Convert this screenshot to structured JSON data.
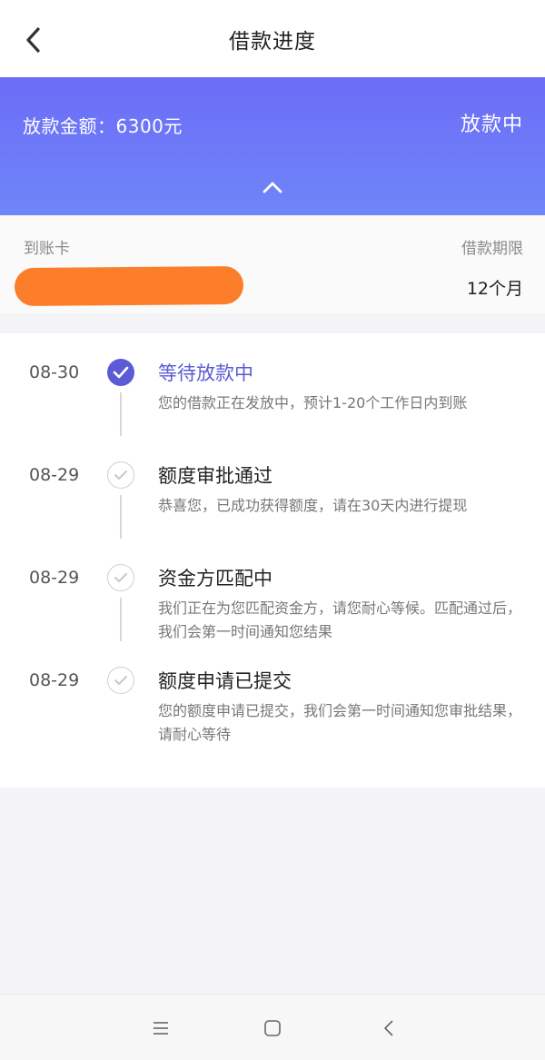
{
  "header": {
    "title": "借款进度",
    "back_icon": "chevron-left-icon"
  },
  "banner": {
    "amount_label": "放款金额：6300元",
    "status": "放款中",
    "collapse_icon": "chevron-up-icon",
    "gradient_start": "#6c6cf7",
    "gradient_end": "#6e86f8"
  },
  "info": {
    "card_label": "到账卡",
    "term_label": "借款期限",
    "term_value": "12个月",
    "card_redaction_color": "#fd7e2a"
  },
  "timeline": {
    "steps": [
      {
        "date": "08-30",
        "title": "等待放款中",
        "description": "您的借款正在发放中，预计1-20个工作日内到账",
        "state": "active",
        "icon": "check-filled-icon"
      },
      {
        "date": "08-29",
        "title": "额度审批通过",
        "description": "恭喜您，已成功获得额度，请在30天内进行提现",
        "state": "done",
        "icon": "check-outline-icon"
      },
      {
        "date": "08-29",
        "title": "资金方匹配中",
        "description": "我们正在为您匹配资金方，请您耐心等候。匹配通过后，我们会第一时间通知您结果",
        "state": "done",
        "icon": "check-outline-icon"
      },
      {
        "date": "08-29",
        "title": "额度申请已提交",
        "description": "您的额度申请已提交，我们会第一时间通知您审批结果，请耐心等待",
        "state": "done",
        "icon": "check-outline-icon"
      }
    ],
    "accent_color": "#5b5bd6"
  },
  "navbar": {
    "menu_icon": "menu-icon",
    "home_icon": "home-square-icon",
    "back_icon": "back-triangle-icon"
  }
}
